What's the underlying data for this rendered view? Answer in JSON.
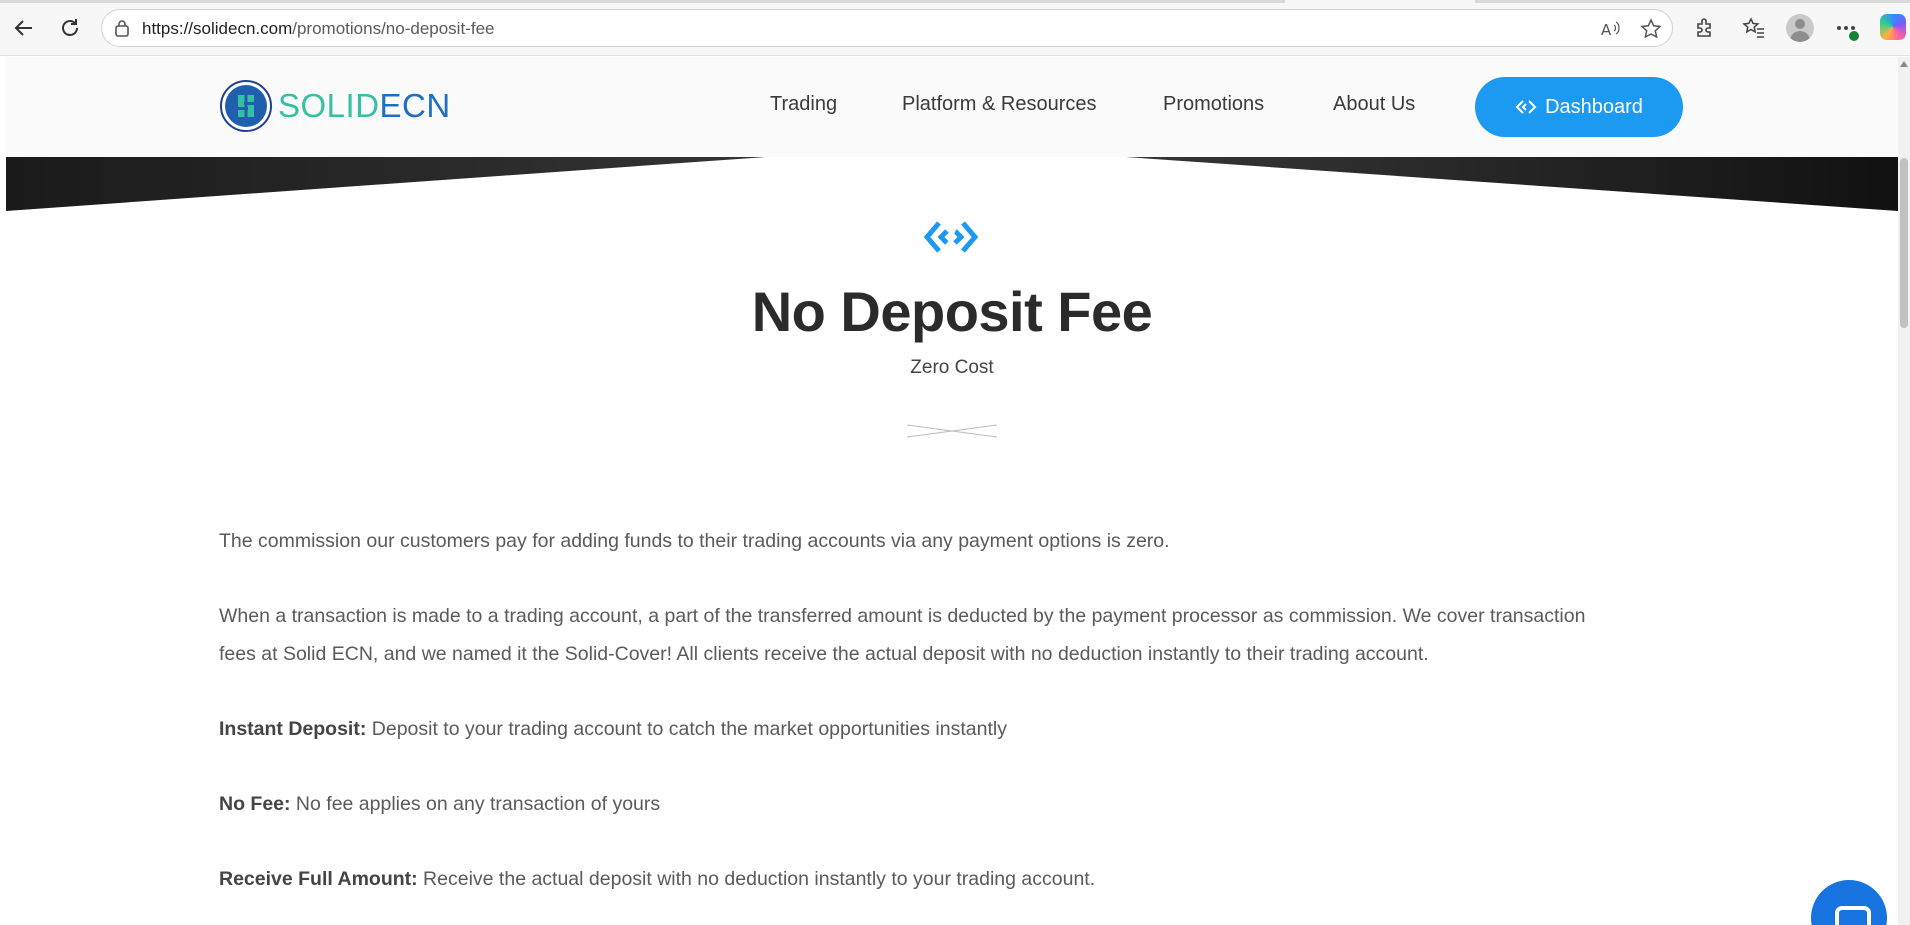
{
  "browser": {
    "url_domain": "https://solidecn.com",
    "url_path": "/promotions/no-deposit-fee",
    "icons": [
      "back-arrow-icon",
      "reload-icon",
      "site-info-icon",
      "read-aloud-icon",
      "favorite-star-icon",
      "extensions-icon",
      "favorites-icon",
      "profile-icon",
      "more-icon",
      "copilot-icon"
    ]
  },
  "header": {
    "logo_part1": "SOLID",
    "logo_part2": "ECN",
    "nav": [
      "Trading",
      "Platform & Resources",
      "Promotions",
      "About Us"
    ],
    "dashboard_label": "Dashboard"
  },
  "hero": {
    "title": "No Deposit Fee",
    "subtitle": "Zero Cost"
  },
  "content": {
    "p1": "The commission our customers pay for adding funds to their trading accounts via any payment options is zero.",
    "p2_line1": "When a transaction is made to a trading account, a part of the transferred amount is deducted by the payment processor as commission. We cover transaction",
    "p2_line2": "fees at Solid ECN, and we named it the Solid-Cover! All clients receive the actual deposit with no deduction instantly to their trading account.",
    "features": [
      {
        "label": "Instant Deposit:",
        "text": " Deposit to your trading account to catch the market opportunities instantly"
      },
      {
        "label": "No Fee:",
        "text": " No fee applies on any transaction of yours"
      },
      {
        "label": "Receive Full Amount:",
        "text": " Receive the actual deposit with no deduction instantly to your trading account."
      }
    ]
  },
  "colors": {
    "brand_blue": "#1c9af2",
    "logo_green": "#35c0a4",
    "logo_blue": "#1f6fc1",
    "chat_blue": "#1773e0"
  }
}
